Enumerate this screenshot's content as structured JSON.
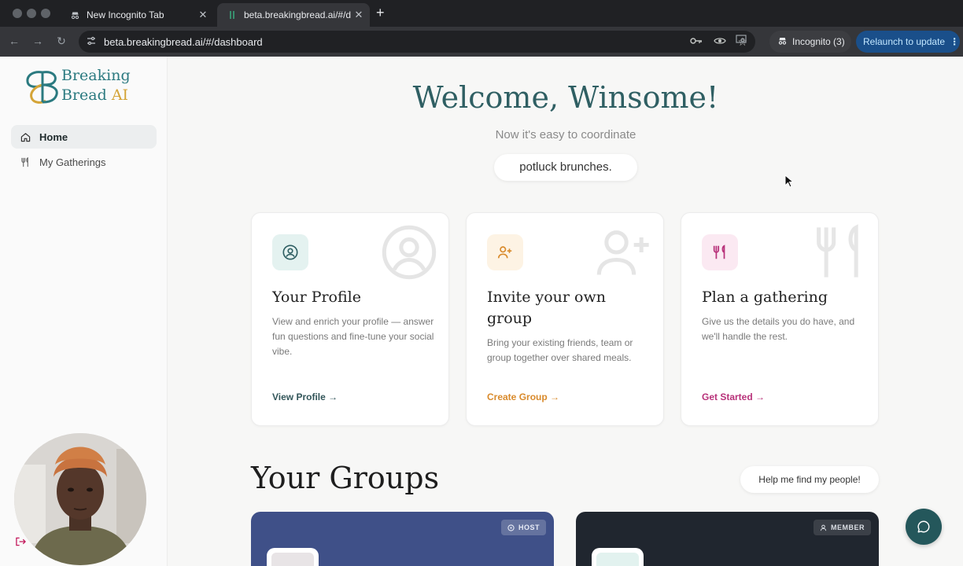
{
  "browser": {
    "tabs": [
      {
        "title": "New Incognito Tab"
      },
      {
        "title": "beta.breakingbread.ai/#/dash"
      }
    ],
    "url": "beta.breakingbread.ai/#/dashboard",
    "incognito_label": "Incognito (3)",
    "relaunch_label": "Relaunch to update"
  },
  "logo": {
    "line1": "Breaking",
    "line2": "Bread",
    "line2_accent": "AI"
  },
  "sidebar": {
    "items": [
      {
        "label": "Home",
        "icon": "home-icon",
        "active": true
      },
      {
        "label": "My Gatherings",
        "icon": "utensils-icon",
        "active": false
      }
    ]
  },
  "hero": {
    "title": "Welcome, Winsome!",
    "subtitle": "Now it's easy to coordinate",
    "rotating_text": "potluck brunches."
  },
  "cards": [
    {
      "title": "Your Profile",
      "description": "View and enrich your profile — answer fun questions and fine-tune your social vibe.",
      "link": "View Profile",
      "icon": "user-circle-icon",
      "accent": "#3b7a7e"
    },
    {
      "title": "Invite your own group",
      "description": "Bring your existing friends, team or group together over shared meals.",
      "link": "Create Group",
      "icon": "user-plus-icon",
      "accent": "#d98a2b"
    },
    {
      "title": "Plan a gathering",
      "description": "Give us the details you do have, and we'll handle the rest.",
      "link": "Get Started",
      "icon": "utensils-icon",
      "accent": "#b8327a"
    }
  ],
  "groups": {
    "title": "Your Groups",
    "help_label": "Help me find my people!",
    "items": [
      {
        "badge": "HOST",
        "color": "#3f5088"
      },
      {
        "badge": "MEMBER",
        "color": "#20262f"
      }
    ]
  }
}
